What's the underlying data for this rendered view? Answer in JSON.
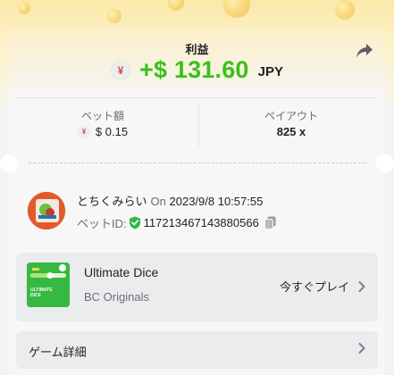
{
  "header": {
    "profit_label": "利益",
    "currency_symbol": "¥",
    "profit_amount": "+$ 131.60",
    "profit_currency": "JPY"
  },
  "stats": {
    "bet_amount_label": "ベット額",
    "bet_amount_value": "$ 0.15",
    "payout_label": "ペイアウト",
    "payout_value": "825 x"
  },
  "user": {
    "name": "とちくみらい",
    "on_label": "On",
    "datetime": "2023/9/8 10:57:55",
    "bet_id_label": "ベットID:",
    "bet_id": "117213467143880566"
  },
  "game": {
    "title": "Ultimate Dice",
    "provider": "BC Originals",
    "play_label": "今すぐプレイ",
    "thumb_text": "ULTIMATE DICE"
  },
  "details": {
    "label": "ゲーム詳細"
  },
  "colors": {
    "profit_green": "#3bc117",
    "yen_red": "#d44a4a",
    "verified_green": "#2fb84c"
  },
  "icons": {
    "share": "share-arrow-icon",
    "currency": "yen-coin-icon",
    "verified": "shield-check-icon",
    "copy": "copy-icon",
    "chevron": "chevron-right-icon"
  }
}
